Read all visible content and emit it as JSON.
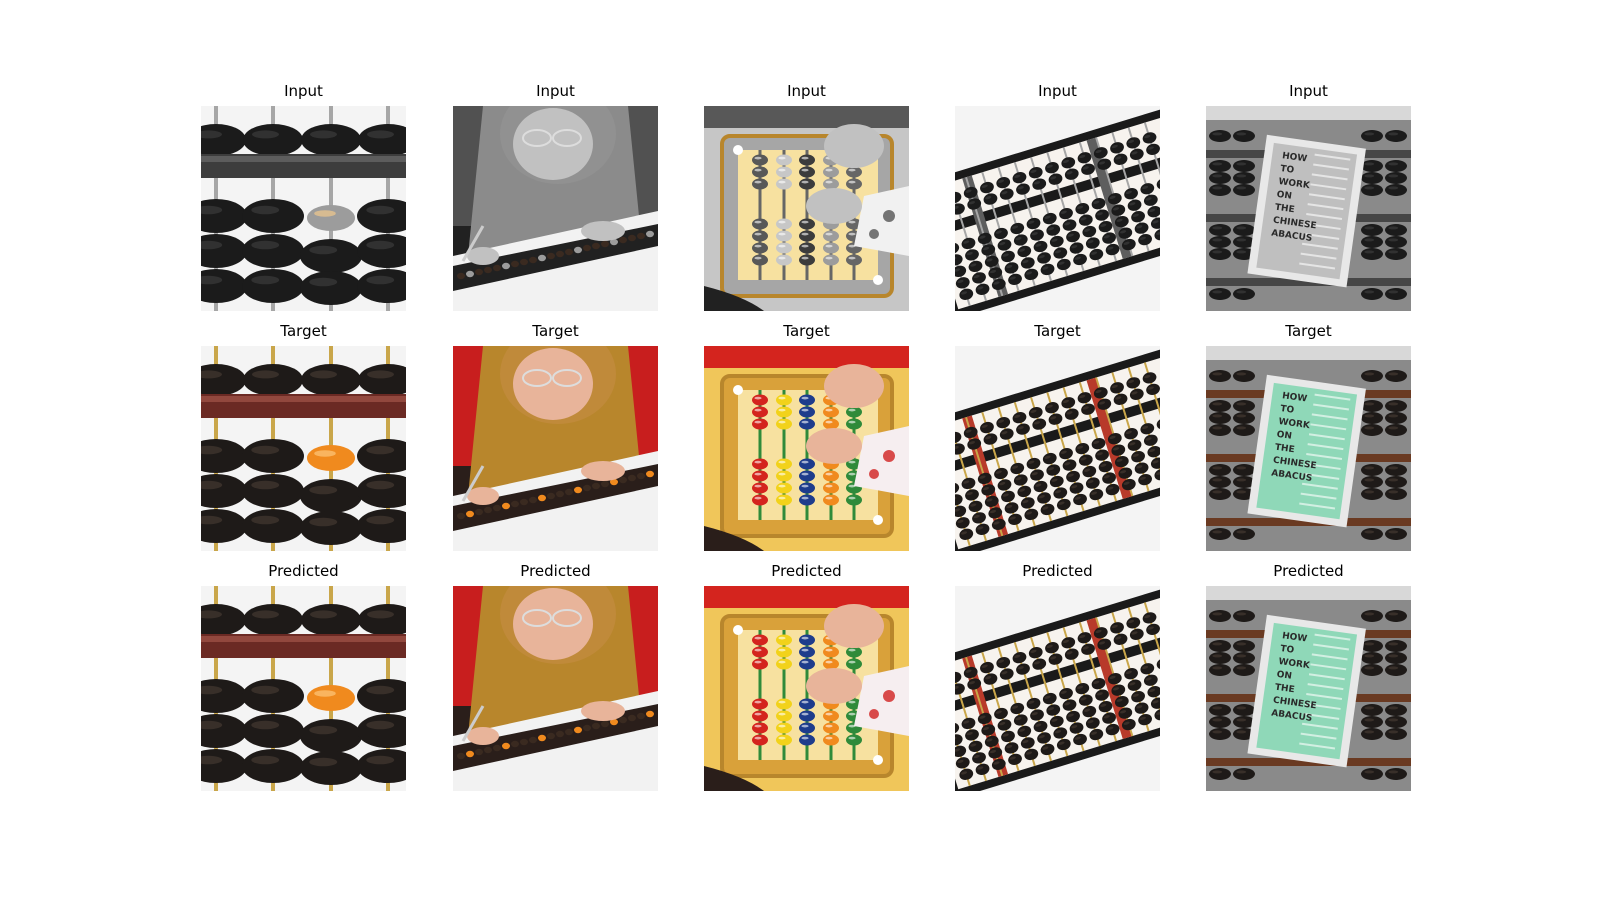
{
  "figure": {
    "rows": [
      {
        "title": "Input",
        "variant": "gray",
        "cells": [
          {
            "scene": "abacus-closeup"
          },
          {
            "scene": "woman-abacus"
          },
          {
            "scene": "child-abacus"
          },
          {
            "scene": "long-abacus"
          },
          {
            "scene": "book-abacus"
          }
        ]
      },
      {
        "title": "Target",
        "variant": "color",
        "cells": [
          {
            "scene": "abacus-closeup"
          },
          {
            "scene": "woman-abacus"
          },
          {
            "scene": "child-abacus"
          },
          {
            "scene": "long-abacus"
          },
          {
            "scene": "book-abacus"
          }
        ]
      },
      {
        "title": "Predicted",
        "variant": "color",
        "cells": [
          {
            "scene": "abacus-closeup"
          },
          {
            "scene": "woman-abacus"
          },
          {
            "scene": "child-abacus"
          },
          {
            "scene": "long-abacus"
          },
          {
            "scene": "book-abacus"
          }
        ]
      }
    ]
  },
  "book": {
    "lines": [
      "HOW",
      "TO",
      "WORK",
      "ON",
      "THE",
      "CHINESE",
      "ABACUS"
    ]
  }
}
